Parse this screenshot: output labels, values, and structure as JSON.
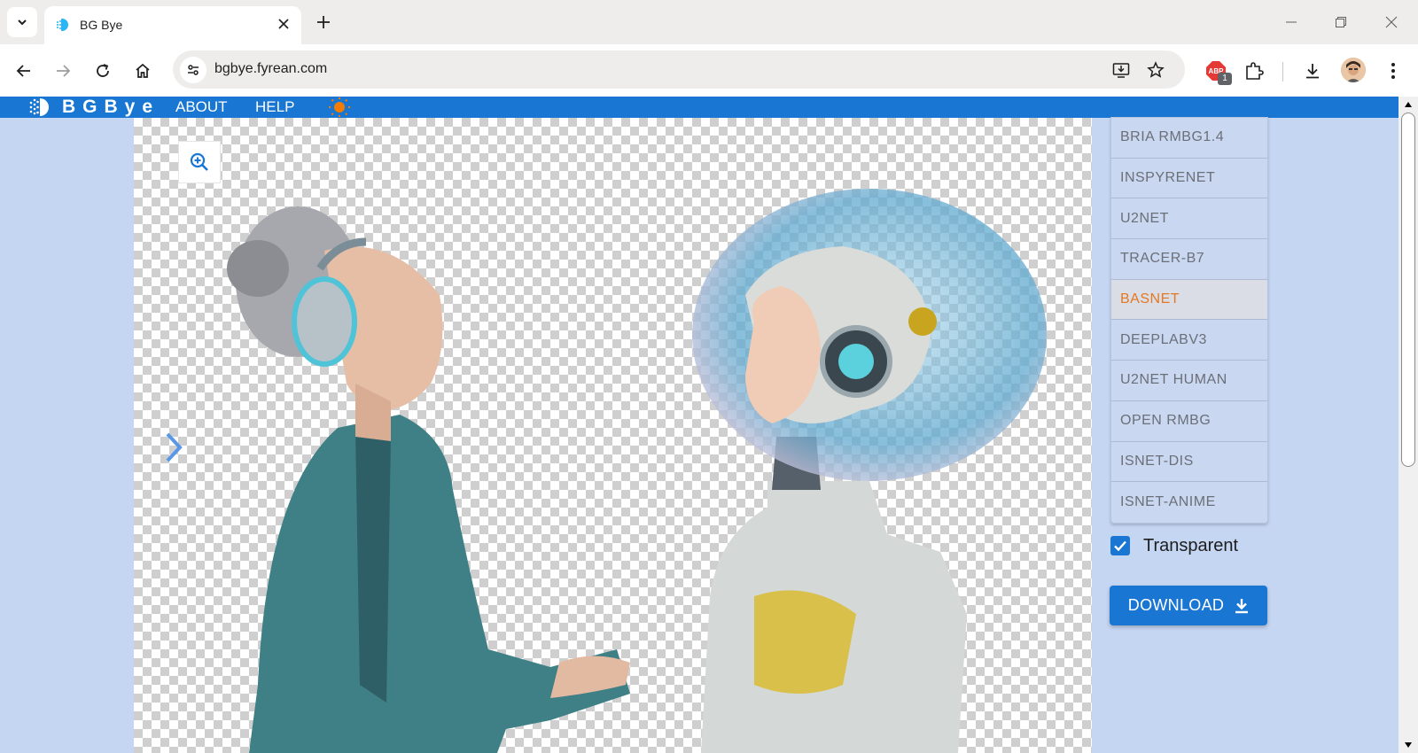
{
  "browser": {
    "tab_title": "BG Bye",
    "url": "bgbye.fyrean.com",
    "extension_badge_count": "1"
  },
  "app": {
    "logo_text": "BGBye",
    "nav": [
      "ABOUT",
      "HELP"
    ],
    "colors": {
      "appbar": "#1976d2",
      "background": "#c5d6f3",
      "selected_model": "#e4781f"
    }
  },
  "models": {
    "items": [
      "BRIA RMBG1.4",
      "INSPYRENET",
      "U2NET",
      "TRACER-B7",
      "BASNET",
      "DEEPLABV3",
      "U2NET HUMAN",
      "OPEN RMBG",
      "ISNET-DIS",
      "ISNET-ANIME"
    ],
    "selected": "BASNET"
  },
  "options": {
    "transparent_label": "Transparent",
    "transparent_checked": true
  },
  "actions": {
    "download_label": "DOWNLOAD"
  },
  "icons": {
    "zoom": "zoom-in-icon",
    "next": "chevron-right-icon",
    "theme": "sun-icon",
    "download": "download-icon"
  }
}
